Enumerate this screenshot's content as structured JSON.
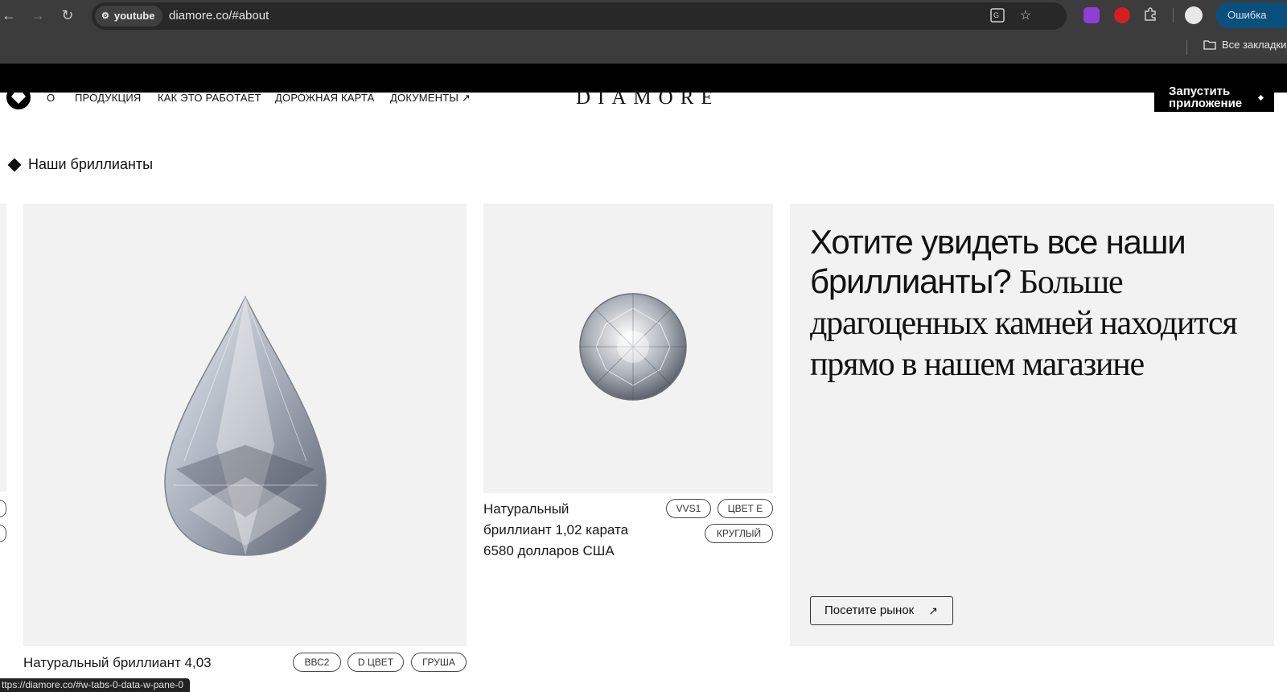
{
  "browser": {
    "site_chip": "youtube",
    "url": "diamore.co/#about",
    "error_button": "Ошибка",
    "bookmarks_label": "Все закладки"
  },
  "nav": {
    "items": [
      "О",
      "ПРОДУКЦИЯ",
      "КАК ЭТО РАБОТАЕТ",
      "ДОРОЖНАЯ КАРТА",
      "ДОКУМЕНТЫ ↗"
    ],
    "brand": "DIAMORE",
    "launch_line1": "Запустить",
    "launch_line2": "приложение"
  },
  "section": {
    "title": "Наши бриллианты"
  },
  "products": [
    {
      "caption": "Натуральный бриллиант 4,03",
      "tags": [
        "ВВС2",
        "D ЦВЕТ",
        "ГРУША"
      ]
    },
    {
      "caption_line1": "Натуральный",
      "caption_line2": "бриллиант 1,02 карата",
      "caption_line3": "6580 долларов США",
      "tags": [
        "VVS1",
        "ЦВЕТ E",
        "КРУГЛЫЙ"
      ]
    }
  ],
  "cta": {
    "title_sans": "Хотите увидеть все наши бриллианты?",
    "title_serif": "Больше драгоценных камней находится прямо в нашем магазине",
    "button": "Посетите рынок",
    "button_arrow": "↗"
  },
  "status_url": "ttps://diamore.co/#w-tabs-0-data-w-pane-0"
}
